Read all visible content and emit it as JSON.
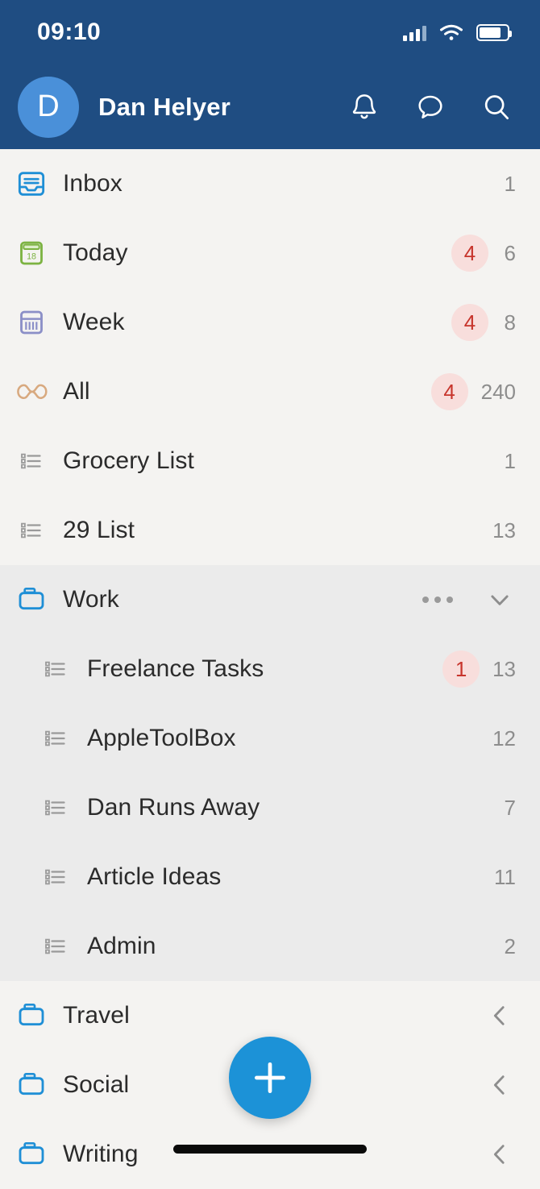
{
  "statusbar": {
    "time": "09:10",
    "icons": [
      "signal-icon",
      "wifi-icon",
      "battery-icon"
    ]
  },
  "header": {
    "avatar_initial": "D",
    "user_name": "Dan Helyer",
    "background_color": "#1f4d82",
    "avatar_color": "#4a90d9",
    "actions": [
      {
        "name": "notifications-icon",
        "label": "Notifications"
      },
      {
        "name": "chat-icon",
        "label": "Chat"
      },
      {
        "name": "search-icon",
        "label": "Search"
      }
    ]
  },
  "smart_lists": [
    {
      "label": "Inbox",
      "icon": "inbox-icon",
      "badge": "",
      "count": "1"
    },
    {
      "label": "Today",
      "icon": "calendar-today-icon",
      "badge": "4",
      "count": "6"
    },
    {
      "label": "Week",
      "icon": "calendar-week-icon",
      "badge": "4",
      "count": "8"
    },
    {
      "label": "All",
      "icon": "infinity-icon",
      "badge": "4",
      "count": "240"
    },
    {
      "label": "Grocery List",
      "icon": "list-icon",
      "badge": "",
      "count": "1"
    },
    {
      "label": "29 List",
      "icon": "list-icon",
      "badge": "",
      "count": "13"
    }
  ],
  "work_group": {
    "label": "Work",
    "icon": "folder-icon",
    "expanded": true,
    "menu_icon": "more-dots-icon",
    "toggle_icon": "chevron-down-icon",
    "background_color": "#ebebeb",
    "children": [
      {
        "label": "Freelance Tasks",
        "icon": "list-icon",
        "badge": "1",
        "count": "13"
      },
      {
        "label": "AppleToolBox",
        "icon": "list-icon",
        "badge": "",
        "count": "12"
      },
      {
        "label": "Dan Runs Away",
        "icon": "list-icon",
        "badge": "",
        "count": "7"
      },
      {
        "label": "Article Ideas",
        "icon": "list-icon",
        "badge": "",
        "count": "11"
      },
      {
        "label": "Admin",
        "icon": "list-icon",
        "badge": "",
        "count": "2"
      }
    ]
  },
  "folders": [
    {
      "label": "Travel",
      "icon": "folder-icon",
      "toggle_icon": "chevron-left-icon"
    },
    {
      "label": "Social",
      "icon": "folder-icon",
      "toggle_icon": "chevron-left-icon"
    },
    {
      "label": "Writing",
      "icon": "folder-icon",
      "toggle_icon": "chevron-left-icon"
    }
  ],
  "fab": {
    "name": "add-button",
    "label": "+",
    "color": "#1c92d7"
  },
  "colors": {
    "badge_bg": "#f8dedc",
    "badge_text": "#c7352c",
    "count_text": "#8d8d8d",
    "page_bg": "#f4f3f1",
    "icon_blue": "#1f8fd6",
    "icon_green": "#7cb342",
    "icon_purple": "#8b8fc7",
    "icon_tan": "#d8a97f",
    "icon_grey": "#9a9a9a"
  }
}
